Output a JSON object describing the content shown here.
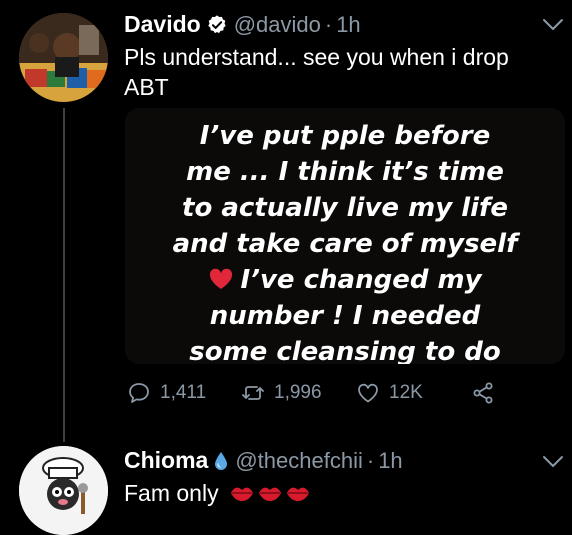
{
  "tweets": [
    {
      "name": "Davido",
      "handle": "@davido",
      "separator": "·",
      "time": "1h",
      "text": "Pls understand... see you when i drop ABT",
      "media_lines": [
        "I’ve put pple before",
        "me ... I think it’s time",
        "to actually live my life",
        "and take care of myself",
        "I’ve changed my",
        "number ! I needed",
        "some cleansing to do"
      ],
      "actions": {
        "replies": "1,411",
        "retweets": "1,996",
        "likes": "12K"
      }
    },
    {
      "name": "Chioma",
      "handle": "@thechefchii",
      "separator": "·",
      "time": "1h",
      "text": "Fam only"
    }
  ],
  "colors": {
    "background": "#000000",
    "text": "#ffffff",
    "muted": "#8b98a5",
    "verified": "#ffffff",
    "thread_line": "#3d4145"
  },
  "icons": [
    "verified-badge-icon",
    "chevron-down-icon",
    "reply-icon",
    "retweet-icon",
    "like-icon",
    "share-icon",
    "droplet-icon",
    "red-heart-icon",
    "kiss-lips-icon"
  ]
}
